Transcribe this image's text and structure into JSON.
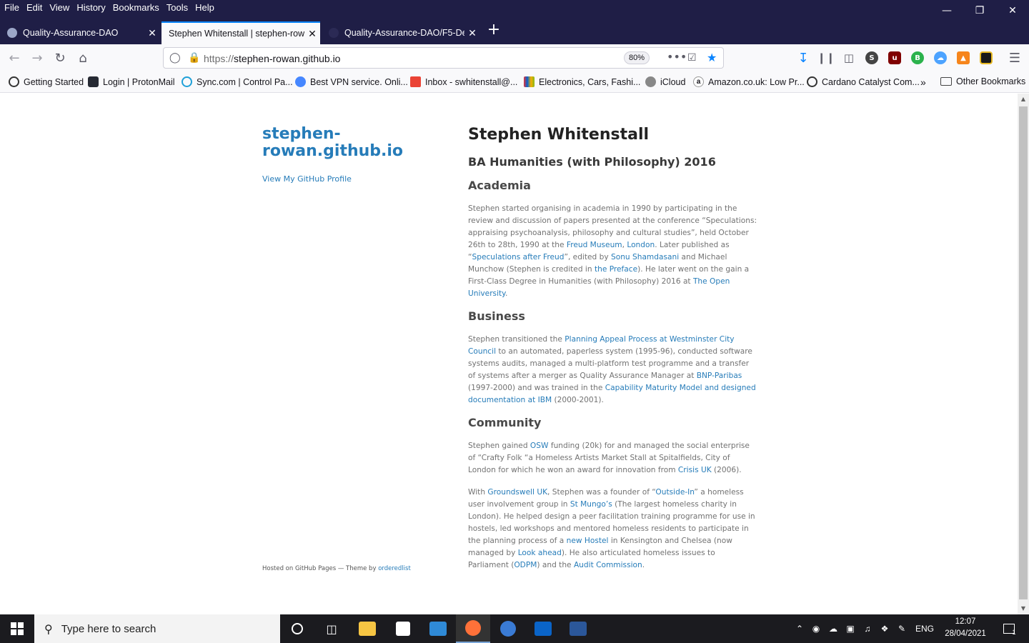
{
  "menu": [
    "File",
    "Edit",
    "View",
    "History",
    "Bookmarks",
    "Tools",
    "Help"
  ],
  "tabs": [
    {
      "label": "Quality-Assurance-DAO"
    },
    {
      "label": "Stephen Whitenstall | stephen-rowan"
    },
    {
      "label": "Quality-Assurance-DAO/F5-De"
    }
  ],
  "url": {
    "proto": "https://",
    "host": "stephen-rowan.github.io",
    "zoom": "80%"
  },
  "bookmarks": [
    "Getting Started",
    "Login | ProtonMail",
    "Sync.com | Control Pa...",
    "Best VPN service. Onli...",
    "Inbox - swhitenstall@...",
    "Electronics, Cars, Fashi...",
    "iCloud",
    "Amazon.co.uk: Low Pr...",
    "Cardano Catalyst Com...",
    "Other Bookmarks"
  ],
  "sidebar": {
    "site_title": "stephen-rowan.github.io",
    "profile_link": "View My GitHub Profile",
    "footer_prefix": "Hosted on GitHub Pages — Theme by ",
    "footer_link": "orderedlist"
  },
  "page": {
    "name": "Stephen Whitenstall",
    "degree": "BA Humanities (with Philosophy) 2016",
    "sections": {
      "academia": {
        "heading": "Academia",
        "t1": "Stephen started organising in academia in 1990 by participating in the review and discussion of papers presented at the conference “Speculations: appraising psychoanalysis, philosophy and cultural studies”, held October 26th to 28th, 1990 at the ",
        "l1": "Freud Museum",
        "t2": ", ",
        "l2": "London",
        "t3": ". Later published as “",
        "l3": "Speculations after Freud",
        "t4": "”, edited by ",
        "l4": "Sonu Shamdasani",
        "t5": " and Michael Munchow (Stephen is credited in ",
        "l5": "the Preface",
        "t6": "). He later went on the gain a First-Class Degree in Humanities (with Philosophy) 2016 at ",
        "l6": "The Open University",
        "t7": "."
      },
      "business": {
        "heading": "Business",
        "t1": "Stephen transitioned the ",
        "l1": "Planning Appeal Process at Westminster City Council",
        "t2": " to an automated, paperless system (1995-96), conducted software systems audits, managed a multi-platform test programme and a transfer of systems after a merger as Quality Assurance Manager at ",
        "l2": "BNP-Paribas",
        "t3": " (1997-2000) and was trained in the ",
        "l3": "Capability Maturity Model and designed documentation at IBM",
        "t4": " (2000-2001)."
      },
      "community": {
        "heading": "Community",
        "p1": {
          "t1": "Stephen gained ",
          "l1": "OSW",
          "t2": " funding (20k) for and managed the social enterprise of “Crafty Folk “a Homeless Artists Market Stall at Spitalfields, City of London for which he won an award for innovation from ",
          "l2": "Crisis UK",
          "t3": " (2006)."
        },
        "p2": {
          "t1": "With ",
          "l1": "Groundswell UK",
          "t2": ", Stephen was a founder of “",
          "l2": "Outside-In",
          "t3": "” a homeless user involvement group in ",
          "l3": "St Mungo’s",
          "t4": " (The largest homeless charity in London). He helped design a peer facilitation training programme for use in hostels, led workshops and mentored homeless residents to participate in the planning process of a ",
          "l4": "new Hostel",
          "t5": " in Kensington and Chelsea (now managed by ",
          "l5": "Look ahead",
          "t6": "). He also articulated homeless issues to Parliament (",
          "l6": "ODPM",
          "t7": ") and the ",
          "l7": "Audit Commission",
          "t8": "."
        }
      }
    }
  },
  "taskbar": {
    "search_placeholder": "Type here to search",
    "lang": "ENG",
    "time": "12:07",
    "date": "28/04/2021",
    "notifications": "1"
  },
  "colors": {
    "link": "#267CB9",
    "chrome_dark": "#1f1e46",
    "accent": "#0a84ff"
  }
}
